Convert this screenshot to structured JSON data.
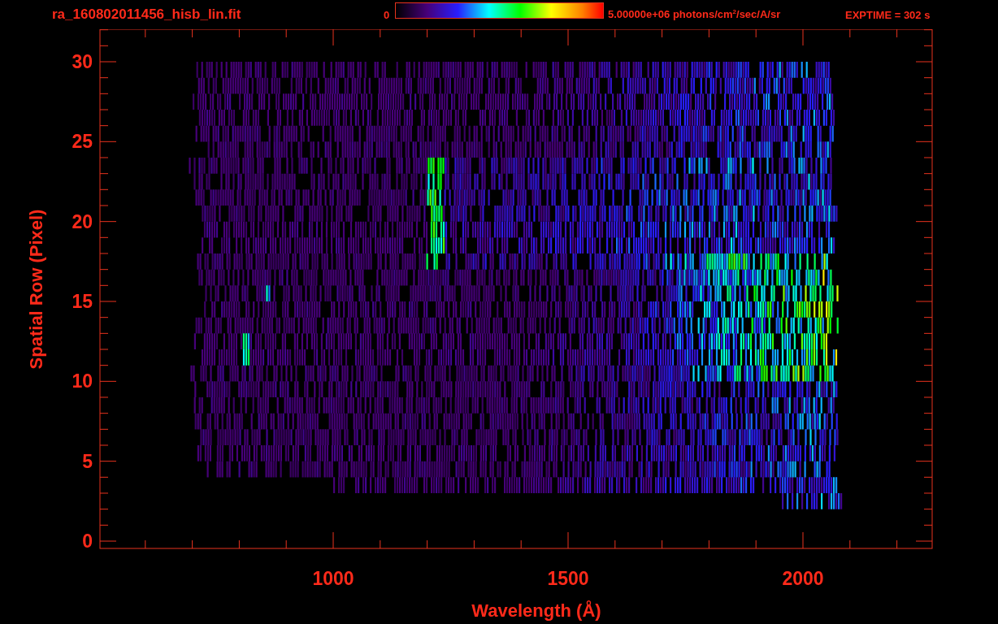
{
  "header": {
    "file_name": "ra_160802011456_hisb_lin.fit",
    "colorbar_min": "0",
    "colorbar_max": "5.00000e+06 photons/cm$^{2}$/sec/A/sr",
    "exposure": "EXPTIME = 302 s"
  },
  "plot": {
    "xlabel": "Wavelength (Å)",
    "ylabel": "Spatial Row (Pixel)",
    "xtick_labels": [
      "1000",
      "1500",
      "2000"
    ],
    "ytick_labels": [
      "30",
      "25",
      "20",
      "15",
      "10",
      "5",
      "0"
    ]
  }
}
